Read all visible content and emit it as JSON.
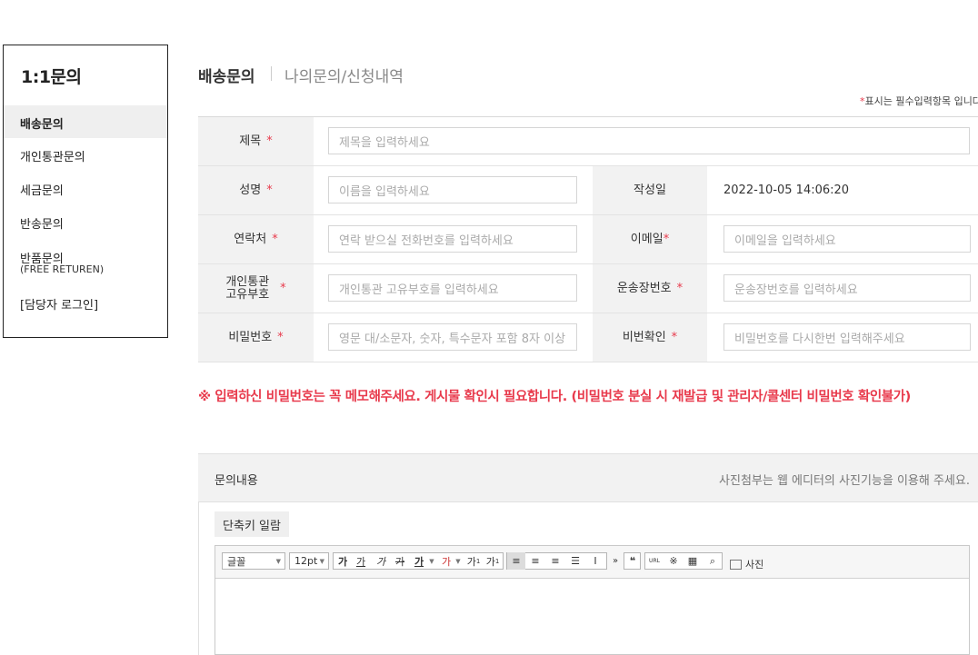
{
  "sidebar": {
    "title": "1:1문의",
    "items": [
      {
        "label": "배송문의",
        "active": true
      },
      {
        "label": "개인통관문의"
      },
      {
        "label": "세금문의"
      },
      {
        "label": "반송문의"
      },
      {
        "label": "반품문의",
        "sub": "(FREE RETUREN)"
      },
      {
        "label": "[담당자 로그인]"
      }
    ]
  },
  "header": {
    "title": "배송문의",
    "sub_title": "나의문의/신청내역",
    "required_mark": "*",
    "required_note": "표시는 필수입력항목 입니다"
  },
  "form": {
    "required_mark": "*",
    "subject": {
      "label": "제목",
      "placeholder": "제목을 입력하세요"
    },
    "name": {
      "label": "성명",
      "placeholder": "이름을 입력하세요"
    },
    "date": {
      "label": "작성일",
      "value": "2022-10-05 14:06:20"
    },
    "phone": {
      "label": "연락처",
      "placeholder": "연락 받으실 전화번호를 입력하세요"
    },
    "email": {
      "label": "이메일",
      "placeholder": "이메일을 입력하세요"
    },
    "customs": {
      "label_line1": "개인통관",
      "label_line2": "고유부호",
      "placeholder": "개인통관 고유부호를 입력하세요"
    },
    "tracking": {
      "label": "운송장번호",
      "placeholder": "운송장번호를 입력하세요"
    },
    "password": {
      "label": "비밀번호",
      "placeholder": "영문 대/소문자, 숫자, 특수문자 포함 8자 이상"
    },
    "password_confirm": {
      "label": "비번확인",
      "placeholder": "비밀번호를 다시한번 입력해주세요"
    }
  },
  "warning": "※ 입력하신 비밀번호는 꼭 메모해주세요. 게시물 확인시 필요합니다. (비밀번호 분실 시 재발급 및 관리자/콜센터 비밀번호 확인불가)",
  "content": {
    "label": "문의내용",
    "note": "사진첨부는 웹 에디터의 사진기능을 이용해 주세요.",
    "shortcut_button": "단축키 일람"
  },
  "editor": {
    "font_select": "글꼴",
    "size_select": "12pt",
    "buttons": [
      "가",
      "가",
      "가",
      "가",
      "가",
      "가",
      "가",
      "가"
    ],
    "photo_label": "사진",
    "icons": [
      "bold-icon",
      "underline-icon",
      "italic-icon",
      "strikethrough-icon",
      "font-color-icon",
      "highlight-icon",
      "superscript-icon",
      "subscript-icon",
      "align-left-icon",
      "align-center-icon",
      "align-right-icon",
      "align-justify-icon",
      "line-height-icon",
      "more-icon",
      "quote-icon",
      "link-icon",
      "special-char-icon",
      "table-icon",
      "find-icon",
      "photo-icon"
    ]
  },
  "colors": {
    "accent_red": "#e83a4c",
    "header_bg": "#f2f2f2"
  }
}
